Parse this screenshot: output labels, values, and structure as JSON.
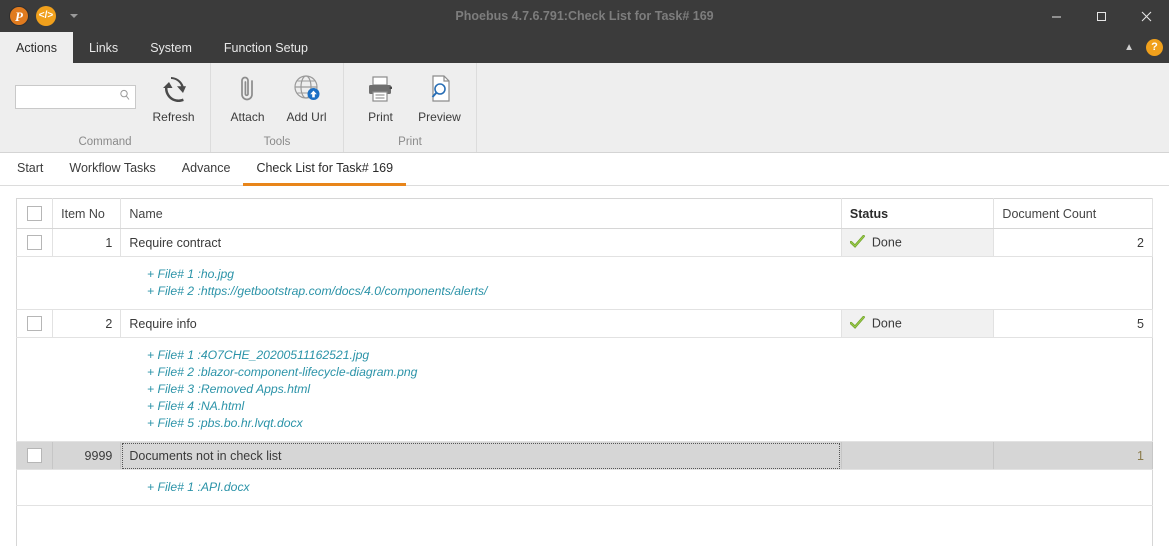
{
  "window": {
    "title": "Phoebus 4.7.6.791:Check List for Task# 169",
    "quick_access": [
      {
        "name": "phoebus-logo-icon",
        "glyph": "P"
      },
      {
        "name": "code-icon",
        "glyph": "</>"
      }
    ],
    "controls": {
      "minimize": "minimize-icon",
      "maximize": "maximize-icon",
      "close": "close-icon"
    }
  },
  "ribbon": {
    "tabs": [
      {
        "label": "Actions",
        "active": true
      },
      {
        "label": "Links",
        "active": false
      },
      {
        "label": "System",
        "active": false
      },
      {
        "label": "Function Setup",
        "active": false
      }
    ],
    "collapse": "▲",
    "help": "?",
    "groups": [
      {
        "label": "Command",
        "search": {
          "value": "",
          "placeholder": ""
        },
        "buttons": [
          {
            "label": "Refresh",
            "icon": "refresh-icon"
          }
        ]
      },
      {
        "label": "Tools",
        "buttons": [
          {
            "label": "Attach",
            "icon": "paperclip-icon"
          },
          {
            "label": "Add Url",
            "icon": "globe-upload-icon"
          }
        ]
      },
      {
        "label": "Print",
        "buttons": [
          {
            "label": "Print",
            "icon": "printer-icon"
          },
          {
            "label": "Preview",
            "icon": "print-preview-icon"
          }
        ]
      }
    ]
  },
  "doc_tabs": [
    {
      "label": "Start",
      "active": false
    },
    {
      "label": "Workflow Tasks",
      "active": false
    },
    {
      "label": "Advance",
      "active": false
    },
    {
      "label": "Check List for Task# 169",
      "active": true
    }
  ],
  "grid": {
    "columns": [
      "",
      "Item No",
      "Name",
      "Status",
      "Document Count"
    ],
    "rows": [
      {
        "checked": false,
        "item_no": "1",
        "name": "Require contract",
        "status": "Done",
        "status_icon": "green-check-icon",
        "doc_count": "2",
        "selected": false,
        "files": [
          "+ File# 1 :ho.jpg",
          "+ File# 2 :https://getbootstrap.com/docs/4.0/components/alerts/"
        ]
      },
      {
        "checked": false,
        "item_no": "2",
        "name": "Require info",
        "status": "Done",
        "status_icon": "green-check-icon",
        "doc_count": "5",
        "selected": false,
        "files": [
          "+ File# 1 :4O7CHE_20200511162521.jpg",
          "+ File# 2 :blazor-component-lifecycle-diagram.png",
          "+ File# 3 :Removed Apps.html",
          "+ File# 4 :NA.html",
          "+ File# 5 :pbs.bo.hr.lvqt.docx"
        ]
      },
      {
        "checked": false,
        "item_no": "9999",
        "name": "Documents not in check list",
        "status": "",
        "status_icon": "",
        "doc_count": "1",
        "selected": true,
        "files": [
          "+ File# 1 :API.docx"
        ]
      }
    ]
  },
  "colors": {
    "accent_orange": "#e8851a",
    "titlebar": "#3b3b3b",
    "ribbon_bg": "#eeeeee",
    "link_teal": "#2b93a8",
    "status_green": "#6fa22a",
    "selected_row": "#d6d6d6"
  }
}
